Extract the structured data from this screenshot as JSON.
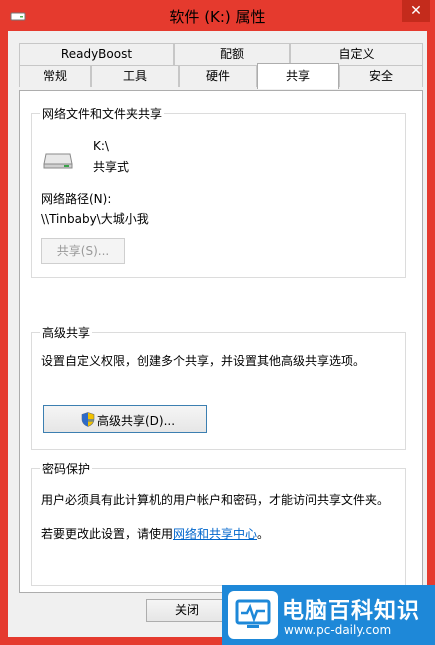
{
  "window": {
    "title": "软件 (K:) 属性",
    "close_glyph": "✕"
  },
  "tabs_row1": [
    {
      "label": "ReadyBoost"
    },
    {
      "label": "配额"
    },
    {
      "label": "自定义"
    }
  ],
  "tabs_row2": [
    {
      "label": "常规"
    },
    {
      "label": "工具"
    },
    {
      "label": "硬件"
    },
    {
      "label": "共享",
      "active": true
    },
    {
      "label": "安全"
    }
  ],
  "network_sharing": {
    "group_title": "网络文件和文件夹共享",
    "drive_name": "K:\\",
    "drive_status": "共享式",
    "path_label": "网络路径(N):",
    "path_value": "\\\\Tinbaby\\大城小我",
    "share_button": "共享(S)..."
  },
  "advanced_sharing": {
    "group_title": "高级共享",
    "description": "设置自定义权限，创建多个共享，并设置其他高级共享选项。",
    "button": "高级共享(D)..."
  },
  "password_protection": {
    "group_title": "密码保护",
    "description": "用户必须具有此计算机的用户帐户和密码，才能访问共享文件夹。",
    "change_prefix": "若要更改此设置，请使用",
    "link": "网络和共享中心",
    "change_suffix": "。"
  },
  "footer": {
    "close_button": "关闭"
  },
  "watermark": {
    "title": "电脑百科知识",
    "url": "www.pc-daily.com"
  },
  "colors": {
    "frame": "#e53a2e",
    "link": "#0066cc",
    "watermark_bg": "#1e88d8"
  }
}
